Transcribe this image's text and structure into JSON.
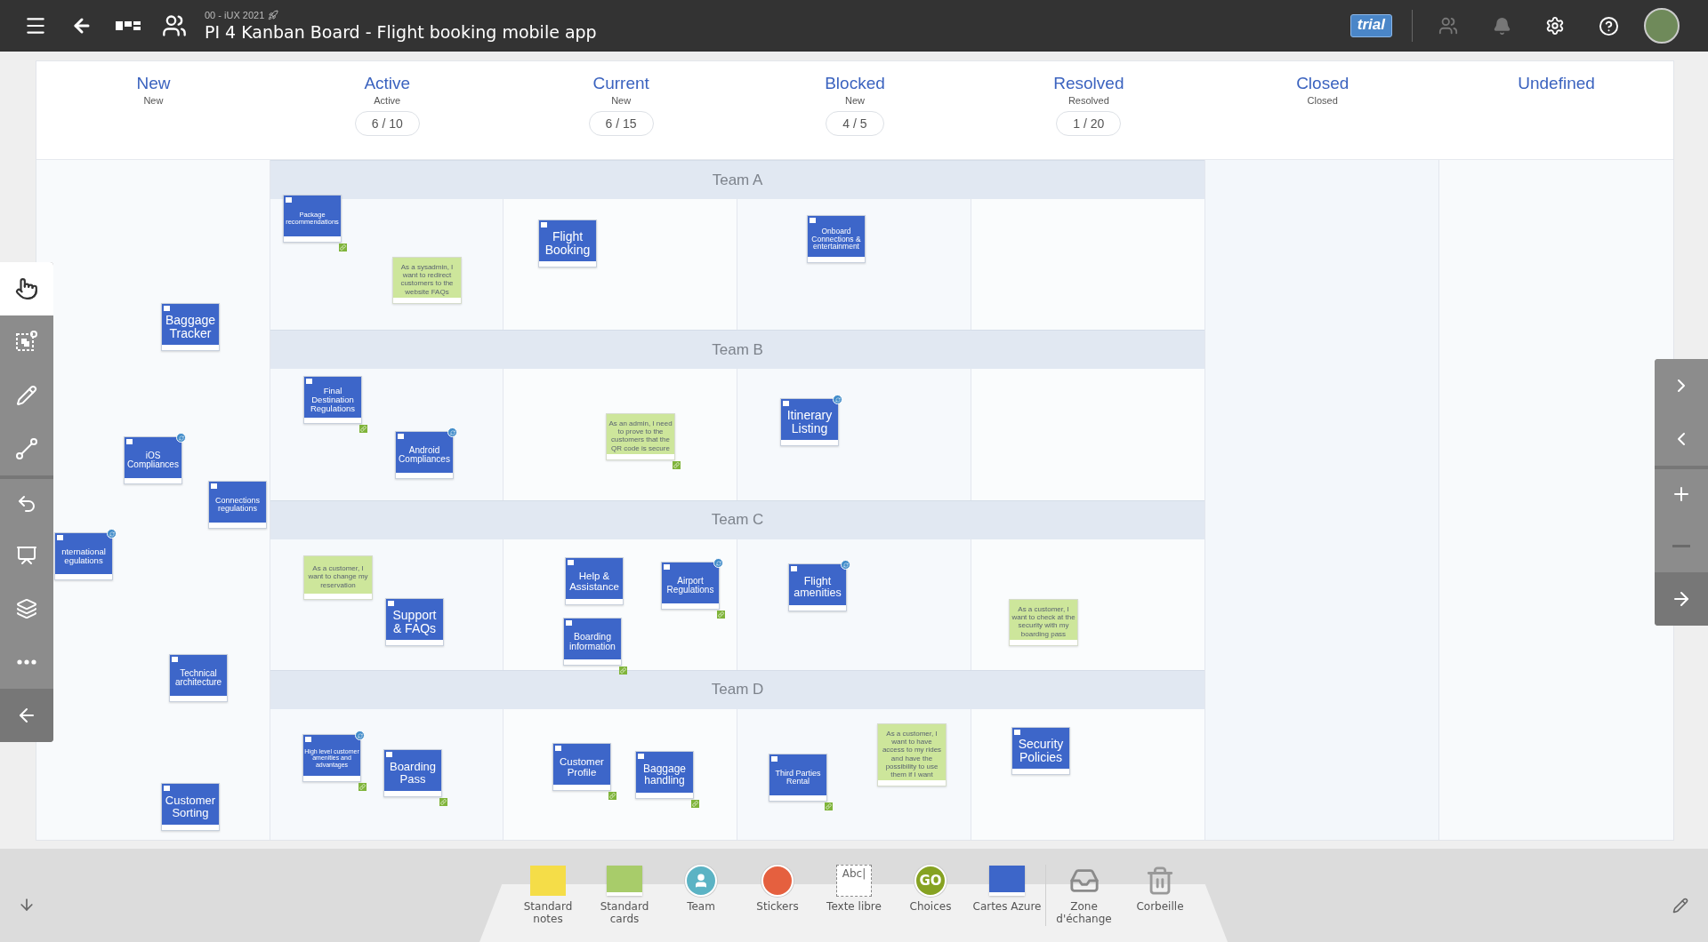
{
  "header": {
    "subtitle": "00 - iUX 2021",
    "title": "PI 4 Kanban Board - Flight booking mobile app",
    "badge": "trial"
  },
  "top_actions": [
    {
      "kind": "people",
      "disabled": true
    },
    {
      "kind": "bell",
      "disabled": true
    },
    {
      "kind": "settings",
      "disabled": false
    },
    {
      "kind": "help",
      "disabled": false
    },
    {
      "kind": "avatar"
    }
  ],
  "columns": [
    {
      "title": "New",
      "subtitle": "New"
    },
    {
      "title": "Active",
      "subtitle": "Active",
      "count": "6 / 10"
    },
    {
      "title": "Current",
      "subtitle": "New",
      "count": "6 / 15"
    },
    {
      "title": "Blocked",
      "subtitle": "New",
      "count": "4 / 5"
    },
    {
      "title": "Resolved",
      "subtitle": "Resolved",
      "count": "1 / 20"
    },
    {
      "title": "Closed",
      "subtitle": "Closed"
    },
    {
      "title": "Undefined"
    }
  ],
  "lanes": [
    "Team A",
    "Team B",
    "Team C",
    "Team D"
  ],
  "cards": [
    {
      "title": "Package recommendations",
      "badge": false,
      "linked": true
    },
    {
      "title": "Flight Booking",
      "badge": false,
      "linked": false
    },
    {
      "title": "Onboard Connections & entertainment",
      "badge": false,
      "linked": false
    },
    {
      "title": "Baggage Tracker",
      "badge": false,
      "linked": false
    },
    {
      "title": "Final Destination Regulations",
      "badge": false,
      "linked": true
    },
    {
      "title": "Android Compliances",
      "badge": true,
      "linked": false
    },
    {
      "title": "Itinerary Listing",
      "badge": true,
      "linked": false
    },
    {
      "title": "iOS Compliances",
      "badge": true,
      "linked": false
    },
    {
      "title": "Connections regulations",
      "badge": false,
      "linked": false
    },
    {
      "title": "nternational egulations",
      "badge": true,
      "linked": false
    },
    {
      "title": "Technical architecture",
      "badge": false,
      "linked": false
    },
    {
      "title": "Customer Sorting",
      "badge": false,
      "linked": false
    },
    {
      "title": "Help & Assistance",
      "badge": false,
      "linked": false
    },
    {
      "title": "Airport Regulations",
      "badge": true,
      "linked": true
    },
    {
      "title": "Boarding information",
      "badge": false,
      "linked": true
    },
    {
      "title": "Support & FAQs",
      "badge": false,
      "linked": false
    },
    {
      "title": "Flight amenities",
      "badge": true,
      "linked": false
    },
    {
      "title": "High level customer amenities and advantages",
      "badge": true,
      "linked": true
    },
    {
      "title": "Boarding Pass",
      "badge": false,
      "linked": true
    },
    {
      "title": "Customer Profile",
      "badge": false,
      "linked": true
    },
    {
      "title": "Baggage handling",
      "badge": false,
      "linked": true
    },
    {
      "title": "Third Parties Rental",
      "badge": false,
      "linked": true
    },
    {
      "title": "Security Policies",
      "badge": false,
      "linked": false
    }
  ],
  "notes": [
    {
      "text": "As a sysadmin, I want to redirect customers to the website FAQs",
      "linked": false
    },
    {
      "text": "As an admin, I need to prove to the customers that the QR code is secure",
      "linked": true
    },
    {
      "text": "As a customer, I want to change my reservation",
      "linked": false
    },
    {
      "text": "As a customer, I want to check at the security with my boarding pass",
      "linked": false
    },
    {
      "text": "As a customer, I want to have access to my rides and have the possibility to use them if I want",
      "linked": false
    }
  ],
  "left_tools": [
    {
      "kind": "hand",
      "selected": true
    },
    {
      "kind": "select",
      "selected": false
    },
    {
      "kind": "pen",
      "selected": false
    },
    {
      "kind": "connector",
      "selected": false
    },
    {
      "kind": "undo",
      "selected": false
    },
    {
      "kind": "present",
      "selected": false
    },
    {
      "kind": "stack",
      "selected": false
    },
    {
      "kind": "more",
      "selected": false
    },
    {
      "kind": "collapse",
      "selected": false
    }
  ],
  "right_tools": [
    {
      "kind": "next",
      "disabled": false
    },
    {
      "kind": "previous",
      "disabled": false
    },
    {
      "kind": "zoom-in",
      "disabled": false
    },
    {
      "kind": "zoom-out",
      "disabled": true
    },
    {
      "kind": "fit",
      "disabled": false
    }
  ],
  "palette": [
    {
      "kind": "notes",
      "label": "Standard notes"
    },
    {
      "kind": "cards",
      "label": "Standard cards"
    },
    {
      "kind": "team",
      "label": "Team"
    },
    {
      "kind": "stickers",
      "label": "Stickers"
    },
    {
      "kind": "text",
      "label": "Texte libre",
      "sample": "Abc|"
    },
    {
      "kind": "choices",
      "label": "Choices",
      "sample": "GO"
    },
    {
      "kind": "azure",
      "label": "Cartes Azure"
    },
    {
      "kind": "exchange",
      "label": "Zone d'échange"
    },
    {
      "kind": "trash",
      "label": "Corbeille"
    }
  ]
}
